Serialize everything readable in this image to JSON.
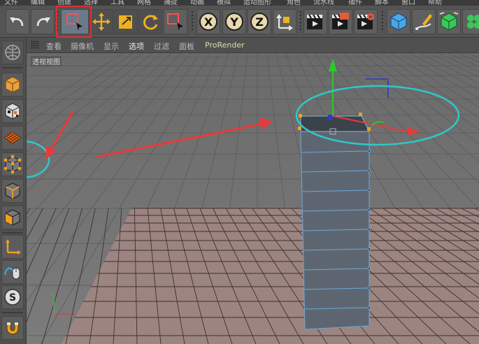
{
  "menubar": {
    "items": [
      "文件",
      "编辑",
      "创建",
      "选择",
      "工具",
      "网格",
      "捕捉",
      "动画",
      "模拟",
      "运动图形",
      "角色",
      "流水线",
      "插件",
      "脚本",
      "窗口",
      "帮助"
    ]
  },
  "toolbar": {
    "undo": "undo-icon",
    "redo": "redo-icon",
    "x_label": "X",
    "y_label": "Y",
    "z_label": "Z"
  },
  "viewport_menu": {
    "items": [
      {
        "label": "查看",
        "active": false
      },
      {
        "label": "摄像机",
        "active": false
      },
      {
        "label": "显示",
        "active": false
      },
      {
        "label": "选项",
        "active": true
      },
      {
        "label": "过滤",
        "active": false
      },
      {
        "label": "面板",
        "active": false
      },
      {
        "label": "ProRender",
        "active": false
      }
    ]
  },
  "viewport": {
    "label": "透视视图",
    "axis_y": "Y",
    "axis_x": "X"
  },
  "colors": {
    "highlight_red": "#e03030",
    "annotation_cyan": "#30c8c8",
    "arrow_red": "#e83a3a",
    "floor": "#9c8580",
    "object": "#5e6670",
    "gizmo_y": "#2ec82e",
    "gizmo_x": "#e83a3a",
    "gizmo_z": "#2a3acc"
  }
}
